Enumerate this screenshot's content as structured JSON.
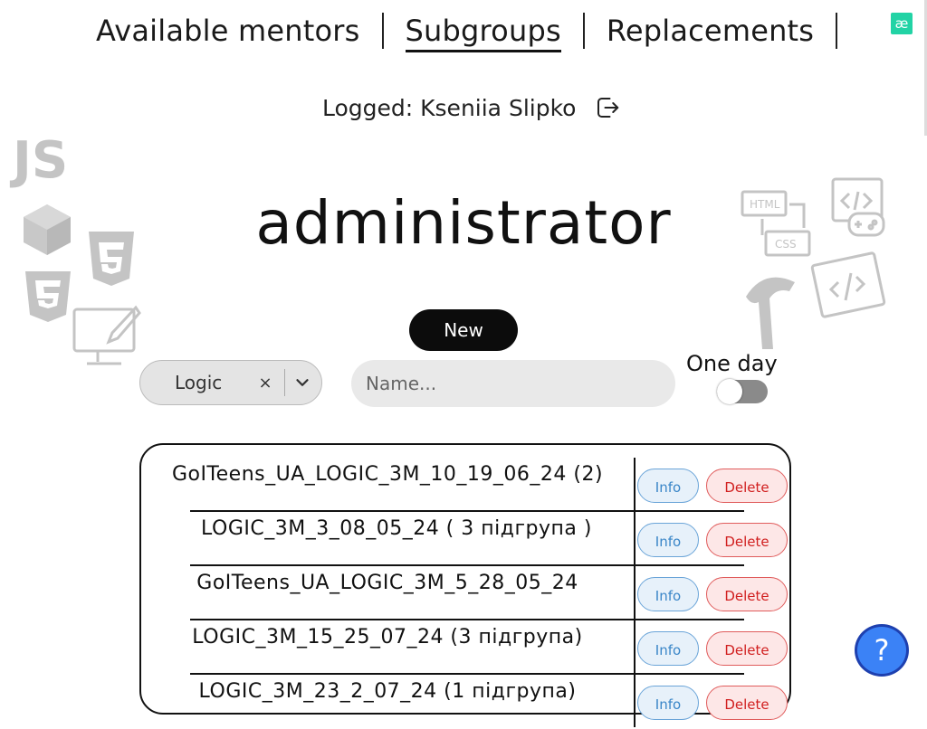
{
  "nav": {
    "items": [
      {
        "label": "Available mentors",
        "active": false
      },
      {
        "label": "Subgroups",
        "active": true
      },
      {
        "label": "Replacements",
        "active": false
      }
    ]
  },
  "badge": {
    "label": "æ"
  },
  "session": {
    "logged_text": "Logged: Kseniia Slipko",
    "logout_icon": "logout-icon"
  },
  "page_title": "administrator",
  "new_button_label": "New",
  "filters": {
    "course_select_value": "Logic",
    "clear_symbol": "×",
    "name_placeholder": "Name...",
    "one_day_label": "One day",
    "one_day_enabled": false
  },
  "subgroups": [
    {
      "name": "GoITeens_UA_LOGIC_3M_10_19_06_24 (2)",
      "info_label": "Info",
      "delete_label": "Delete"
    },
    {
      "name": "LOGIC_3M_3_08_05_24 ( 3 підгрупа )",
      "info_label": "Info",
      "delete_label": "Delete"
    },
    {
      "name": "GoITeens_UA_LOGIC_3M_5_28_05_24",
      "info_label": "Info",
      "delete_label": "Delete"
    },
    {
      "name": "LOGIC_3M_15_25_07_24 (3 підгрупа)",
      "info_label": "Info",
      "delete_label": "Delete"
    },
    {
      "name": "LOGIC_3M_23_2_07_24 (1 підгрупа)",
      "info_label": "Info",
      "delete_label": "Delete"
    }
  ],
  "help_button_symbol": "?",
  "colors": {
    "accent_badge": "#22d3a5",
    "help_button": "#3b82f6",
    "info_text": "#3a86c8",
    "delete_text": "#d12020"
  }
}
